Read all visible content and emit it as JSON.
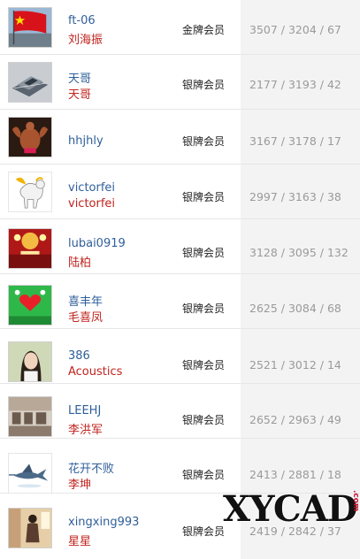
{
  "members": [
    {
      "username": "ft-06",
      "nickname": "刘海振",
      "level": "金牌会员",
      "stats": "3507 / 3204 / 67",
      "avatar_icon": "china-flag-avatar-icon"
    },
    {
      "username": "天哥",
      "nickname": "天哥",
      "level": "银牌会员",
      "stats": "2177 / 3193 / 42",
      "avatar_icon": "building-model-avatar-icon"
    },
    {
      "username": "hhjhly",
      "nickname": "",
      "level": "银牌会员",
      "stats": "3167 / 3178 / 17",
      "avatar_icon": "bodybuilder-avatar-icon"
    },
    {
      "username": "victorfei",
      "nickname": "victorfei",
      "level": "银牌会员",
      "stats": "2997 / 3163 / 38",
      "avatar_icon": "pegasus-avatar-icon"
    },
    {
      "username": "lubai0919",
      "nickname": "陆柏",
      "level": "银牌会员",
      "stats": "3128 / 3095 / 132",
      "avatar_icon": "stage-lights-avatar-icon"
    },
    {
      "username": "喜丰年",
      "nickname": "毛喜凤",
      "level": "银牌会员",
      "stats": "2625 / 3084 / 68",
      "avatar_icon": "green-heart-avatar-icon"
    },
    {
      "username": "386",
      "nickname": "Acoustics",
      "level": "银牌会员",
      "stats": "2521 / 3012 / 14",
      "avatar_icon": "woman-portrait-avatar-icon"
    },
    {
      "username": "LEEHJ",
      "nickname": "李洪军",
      "level": "银牌会员",
      "stats": "2652 / 2963 / 49",
      "avatar_icon": "office-room-avatar-icon"
    },
    {
      "username": "花开不败",
      "nickname": "李坤",
      "level": "银牌会员",
      "stats": "2413 / 2881 / 18",
      "avatar_icon": "swordfish-avatar-icon"
    },
    {
      "username": "xingxing993",
      "nickname": "星星",
      "level": "银牌会员",
      "stats": "2419 / 2842 / 37",
      "avatar_icon": "woman-standing-avatar-icon"
    }
  ],
  "watermark": {
    "text": "XYCAD",
    "suffix": ".com"
  },
  "colors": {
    "username": "#2f5f9a",
    "nickname": "#c0231e",
    "stats": "#9a9a9a",
    "stats_bg": "#f3f3f3"
  }
}
